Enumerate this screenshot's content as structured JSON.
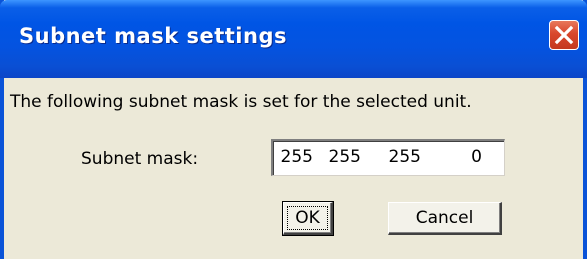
{
  "window": {
    "title": "Subnet mask settings",
    "close_icon": "close-x-icon",
    "accent": "#0055e5",
    "close_color": "#d9472c"
  },
  "dialog": {
    "message": "The following subnet mask is set for the selected unit.",
    "field_label": "Subnet mask:",
    "subnet_mask": {
      "octet1": "255",
      "octet2": "255",
      "octet3": "255",
      "octet4": "0"
    },
    "ok_label": "OK",
    "cancel_label": "Cancel"
  }
}
